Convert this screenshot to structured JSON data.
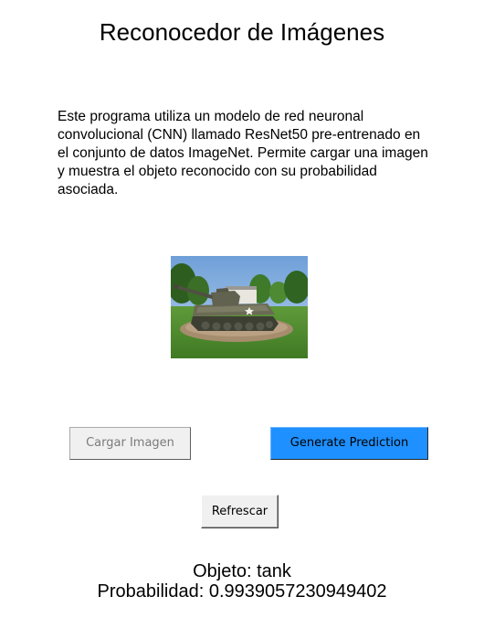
{
  "app": {
    "title": "Reconocedor de Imágenes",
    "description": "Este programa utiliza un modelo de red neuronal convolucional (CNN) llamado ResNet50 pre-entrenado en el conjunto de datos ImageNet. Permite cargar una imagen y muestra el objeto reconocido con su probabilidad asociada."
  },
  "image": {
    "subject": "tank-photo"
  },
  "buttons": {
    "load_label": "Cargar Imagen",
    "predict_label": "Generate Prediction",
    "refresh_label": "Refrescar"
  },
  "result": {
    "object_text": "Objeto: tank",
    "probability_text": "Probabilidad: 0.9939057230949402"
  },
  "colors": {
    "predict_button": "#1e90ff",
    "disabled_text": "#7a7a7a",
    "background": "#ffffff"
  }
}
